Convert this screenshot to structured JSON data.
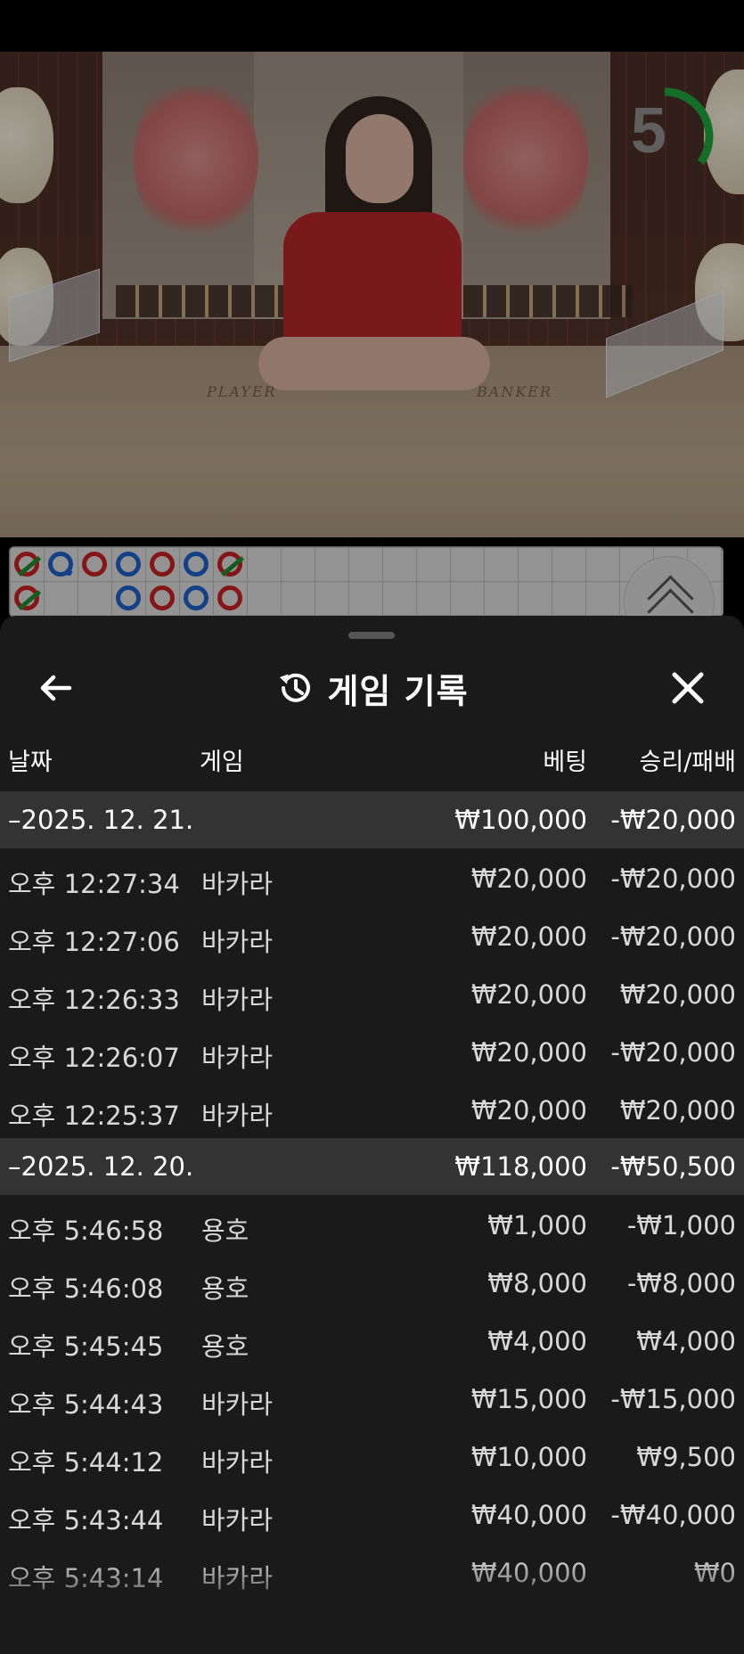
{
  "video": {
    "countdown": "5",
    "countdown_fraction": 0.35,
    "table_labels": {
      "player": "PLAYER",
      "banker": "BANKER"
    }
  },
  "roadmap": {
    "beads": [
      {
        "col": 0,
        "row": 0,
        "color": "red",
        "tie": true
      },
      {
        "col": 1,
        "row": 0,
        "color": "blue",
        "dot": true
      },
      {
        "col": 2,
        "row": 0,
        "color": "red"
      },
      {
        "col": 3,
        "row": 0,
        "color": "blue"
      },
      {
        "col": 4,
        "row": 0,
        "color": "red"
      },
      {
        "col": 5,
        "row": 0,
        "color": "blue"
      },
      {
        "col": 6,
        "row": 0,
        "color": "red",
        "tie": true
      },
      {
        "col": 0,
        "row": 1,
        "color": "red",
        "tie": true
      },
      {
        "col": 3,
        "row": 1,
        "color": "blue"
      },
      {
        "col": 4,
        "row": 1,
        "color": "red"
      },
      {
        "col": 5,
        "row": 1,
        "color": "blue"
      },
      {
        "col": 6,
        "row": 1,
        "color": "red"
      }
    ],
    "expand_icon": "chevron-up-double-icon"
  },
  "sheet": {
    "title": "게임 기록",
    "back_icon": "arrow-left-icon",
    "title_icon": "history-icon",
    "close_icon": "close-icon",
    "columns": {
      "date": "날짜",
      "game": "게임",
      "bet": "베팅",
      "result": "승리/패배"
    },
    "groups": [
      {
        "date": "–2025. 12. 21.",
        "bet_total": "₩100,000",
        "result_total": "-₩20,000",
        "rows": [
          {
            "time": "오후 12:27:34",
            "game": "바카라",
            "bet": "₩20,000",
            "result": "-₩20,000"
          },
          {
            "time": "오후 12:27:06",
            "game": "바카라",
            "bet": "₩20,000",
            "result": "-₩20,000"
          },
          {
            "time": "오후 12:26:33",
            "game": "바카라",
            "bet": "₩20,000",
            "result": "₩20,000"
          },
          {
            "time": "오후 12:26:07",
            "game": "바카라",
            "bet": "₩20,000",
            "result": "-₩20,000"
          },
          {
            "time": "오후 12:25:37",
            "game": "바카라",
            "bet": "₩20,000",
            "result": "₩20,000"
          }
        ]
      },
      {
        "date": "–2025. 12. 20.",
        "bet_total": "₩118,000",
        "result_total": "-₩50,500",
        "rows": [
          {
            "time": "오후 5:46:58",
            "game": "용호",
            "bet": "₩1,000",
            "result": "-₩1,000"
          },
          {
            "time": "오후 5:46:08",
            "game": "용호",
            "bet": "₩8,000",
            "result": "-₩8,000"
          },
          {
            "time": "오후 5:45:45",
            "game": "용호",
            "bet": "₩4,000",
            "result": "₩4,000"
          },
          {
            "time": "오후 5:44:43",
            "game": "바카라",
            "bet": "₩15,000",
            "result": "-₩15,000"
          },
          {
            "time": "오후 5:44:12",
            "game": "바카라",
            "bet": "₩10,000",
            "result": "₩9,500"
          },
          {
            "time": "오후 5:43:44",
            "game": "바카라",
            "bet": "₩40,000",
            "result": "-₩40,000"
          },
          {
            "time": "오후 5:43:14",
            "game": "바카라",
            "bet": "₩40,000",
            "result": "₩0"
          }
        ]
      }
    ]
  },
  "colors": {
    "red_bead": "#c42121",
    "blue_bead": "#1e5fc4",
    "tie_slash": "#1f8a2e",
    "timer_arc": "#1fa33a"
  }
}
